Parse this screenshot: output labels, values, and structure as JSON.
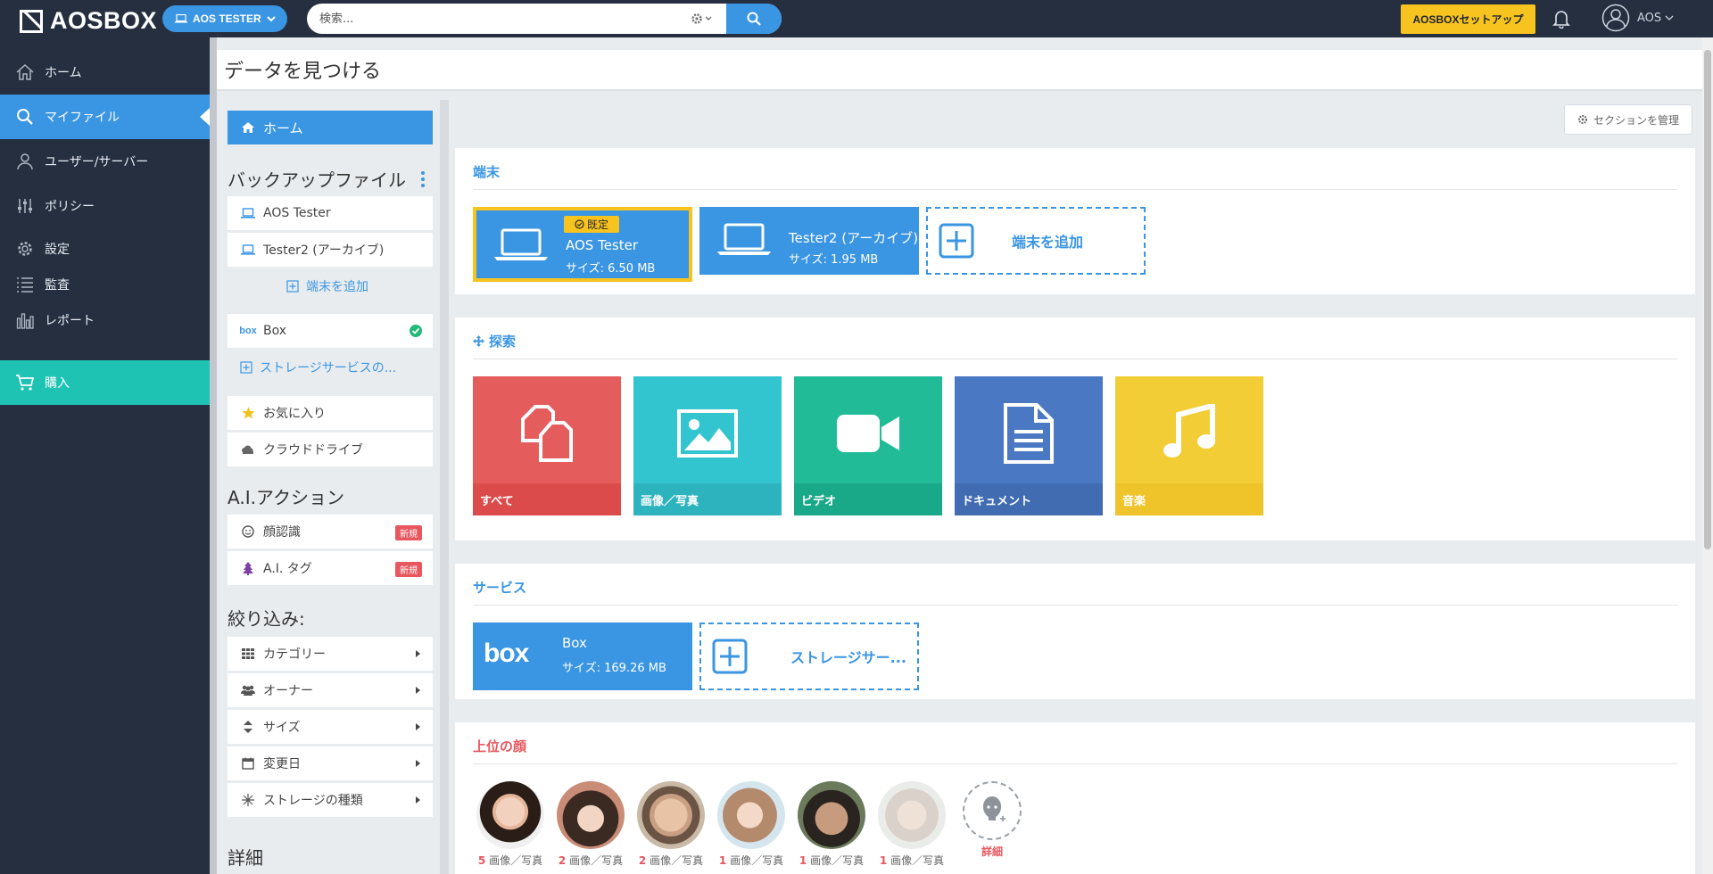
{
  "app": {
    "logo": "AOSBOX",
    "user_pill": "AOS TESTER",
    "setup_button": "AOSBOXセットアップ",
    "account_name": "AOS"
  },
  "search": {
    "placeholder": "検索..."
  },
  "nav": {
    "items": [
      {
        "label": "ホーム",
        "icon": "home-icon"
      },
      {
        "label": "マイファイル",
        "icon": "search-icon"
      },
      {
        "label": "ユーザー/サーバー",
        "icon": "user-icon"
      },
      {
        "label": "ポリシー",
        "icon": "sliders-icon"
      },
      {
        "label": "設定",
        "icon": "gear-icon"
      },
      {
        "label": "監査",
        "icon": "list-icon"
      },
      {
        "label": "レポート",
        "icon": "bar-chart-icon"
      },
      {
        "label": "購入",
        "icon": "cart-icon"
      }
    ]
  },
  "header": {
    "title": "データを見つける"
  },
  "filters": {
    "home": "ホーム",
    "backup_title": "バックアップファイル",
    "devices": [
      "AOS Tester",
      "Tester2 (アーカイブ)"
    ],
    "add_device": "端末を追加",
    "box": "Box",
    "add_storage": "ストレージサービスの...",
    "favorites": "お気に入り",
    "cloud_drive": "クラウドドライブ",
    "ai_title": "A.I.アクション",
    "face_recognition": "顔認識",
    "ai_tag": "A.I. タグ",
    "new_badge": "新規",
    "narrow_title": "絞り込み:",
    "narrow_items": [
      "カテゴリー",
      "オーナー",
      "サイズ",
      "変更日",
      "ストレージの種類"
    ],
    "details_title": "詳細"
  },
  "main": {
    "manage_sections": "セクションを管理",
    "devices_title": "端末",
    "devices": [
      {
        "default_badge": "既定",
        "name": "AOS Tester",
        "size": "サイズ: 6.50 MB"
      },
      {
        "name": "Tester2 (アーカイブ)",
        "size": "サイズ: 1.95 MB"
      }
    ],
    "add_device": "端末を追加",
    "explore_title": "探索",
    "explore_tiles": [
      {
        "label": "すべて",
        "color": "#e45c5c",
        "foot": "#dc4b4c"
      },
      {
        "label": "画像／写真",
        "color": "#33c5cf",
        "foot": "#2db3bd"
      },
      {
        "label": "ビデオ",
        "color": "#21bb98",
        "foot": "#1aa988"
      },
      {
        "label": "ドキュメント",
        "color": "#4a78c2",
        "foot": "#416cb2"
      },
      {
        "label": "音楽",
        "color": "#f2cd35",
        "foot": "#eec42a"
      }
    ],
    "services_title": "サービス",
    "service": {
      "logo": "box",
      "name": "Box",
      "size": "サイズ: 169.26 MB"
    },
    "add_storage": "ストレージサー...",
    "faces_title": "上位の顔",
    "faces": [
      {
        "count": "5",
        "unit": "画像／写真"
      },
      {
        "count": "2",
        "unit": "画像／写真"
      },
      {
        "count": "2",
        "unit": "画像／写真"
      },
      {
        "count": "1",
        "unit": "画像／写真"
      },
      {
        "count": "1",
        "unit": "画像／写真"
      },
      {
        "count": "1",
        "unit": "画像／写真"
      }
    ],
    "faces_detail": "詳細"
  }
}
